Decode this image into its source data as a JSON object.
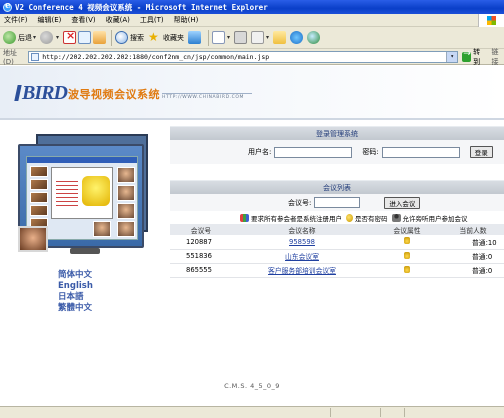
{
  "window": {
    "title": "V2 Conference 4 视频会议系统 - Microsoft Internet Explorer"
  },
  "menu": [
    "文件(F)",
    "编辑(E)",
    "查看(V)",
    "收藏(A)",
    "工具(T)",
    "帮助(H)"
  ],
  "toolbar": {
    "back_label": "后退",
    "search_label": "搜索",
    "favorites_label": "收藏夹"
  },
  "address": {
    "label": "地址(D)",
    "url": "http://202.202.202.202:1880/conf2nm_cn/jsp/common/main.jsp",
    "go_label": "转到",
    "links_label": "链接"
  },
  "banner": {
    "logo": "BIRD",
    "product": "波导视频会议系统",
    "url_text": "HTTP://WWW.CHINABIRD.COM"
  },
  "languages": [
    "简体中文",
    "English",
    "日本語",
    "繁體中文"
  ],
  "login": {
    "header": "登录管理系统",
    "username_label": "用户名:",
    "password_label": "密码:",
    "login_button": "登录"
  },
  "meetings": {
    "header": "会议列表",
    "id_label": "会议号:",
    "enter_button": "进入会议",
    "legend_users": "要求所有参会者是系统注册用户",
    "legend_password": "是否有密码",
    "legend_anonymous": "允许旁听用户参加会议",
    "columns": [
      "会议号",
      "会议名称",
      "会议属性",
      "当前人数"
    ],
    "rows": [
      {
        "id": "120887",
        "name": "958598",
        "count": "普通:10"
      },
      {
        "id": "551836",
        "name": "山东会议室",
        "count": "普通:0"
      },
      {
        "id": "865555",
        "name": "客户服务部培训会议室",
        "count": "普通:0"
      }
    ]
  },
  "footer": {
    "version": "C.M.S. 4_5_0_9"
  }
}
